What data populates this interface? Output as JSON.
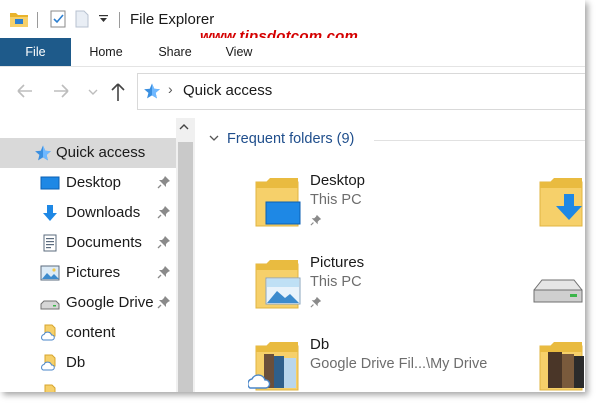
{
  "window": {
    "title": "File Explorer"
  },
  "watermark": "www.tipsdotcom.com",
  "ribbon": {
    "tabs": [
      "File",
      "Home",
      "Share",
      "View"
    ]
  },
  "address": {
    "path": "Quick access"
  },
  "navpane": {
    "items": [
      {
        "label": "Quick access",
        "icon": "star-icon",
        "pinned": false,
        "selected": true
      },
      {
        "label": "Desktop",
        "icon": "desktop-icon",
        "pinned": true
      },
      {
        "label": "Downloads",
        "icon": "downloads-icon",
        "pinned": true
      },
      {
        "label": "Documents",
        "icon": "documents-icon",
        "pinned": true
      },
      {
        "label": "Pictures",
        "icon": "pictures-icon",
        "pinned": true
      },
      {
        "label": "Google Drive",
        "icon": "drive-icon",
        "pinned": true
      },
      {
        "label": "content",
        "icon": "cloud-folder-icon",
        "pinned": false
      },
      {
        "label": "Db",
        "icon": "cloud-folder-icon",
        "pinned": false
      }
    ]
  },
  "content": {
    "group_label": "Frequent folders (9)",
    "tiles": [
      {
        "name": "Desktop",
        "location": "This PC",
        "pinned": true,
        "icon": "desktop-folder-icon"
      },
      {
        "name": "Pictures",
        "location": "This PC",
        "pinned": true,
        "icon": "pictures-folder-icon"
      },
      {
        "name": "Db",
        "location": "Google Drive Fil...\\My Drive",
        "pinned": false,
        "icon": "cloud-folder-icon"
      }
    ]
  },
  "colors": {
    "file_tab": "#1e5a8a",
    "group_header": "#1f4e8c",
    "watermark": "#d40000",
    "selected": "#d9d9d9"
  }
}
